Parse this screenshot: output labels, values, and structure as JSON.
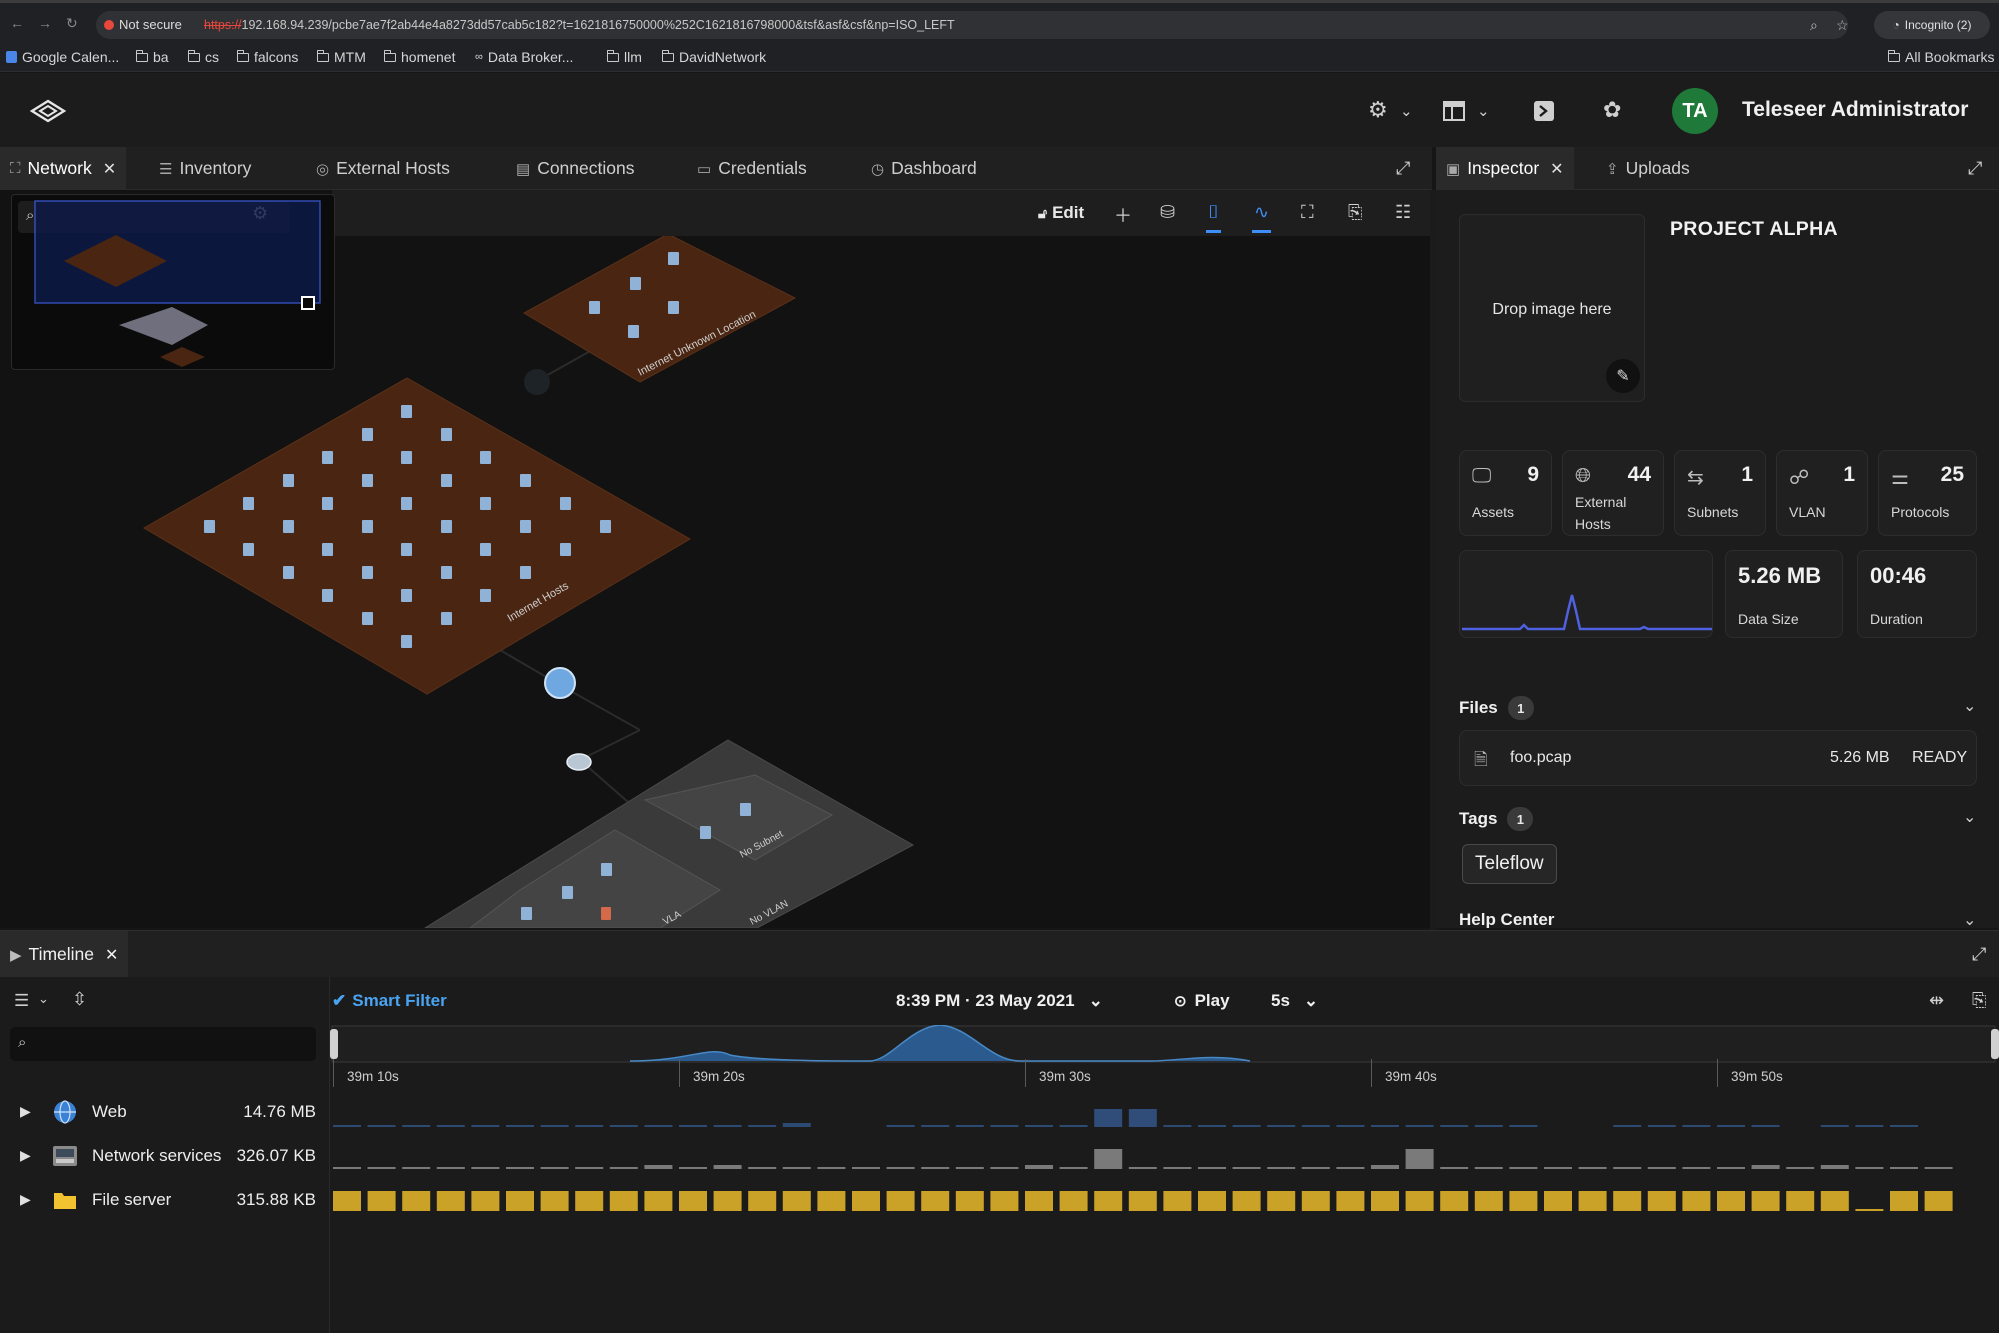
{
  "browser": {
    "not_secure": "Not secure",
    "url_scheme": "https://",
    "url_rest": "192.168.94.239/pcbe7ae7f2ab44e4a8273dd57cab5c182?t=1621816750000%252C1621816798000&tsf&asf&csf&np=ISO_LEFT",
    "incognito": "Incognito (2)",
    "bookmarks": [
      "Google Calen...",
      "ba",
      "cs",
      "falcons",
      "MTM",
      "homenet",
      "Data Broker...",
      "llm",
      "DavidNetwork"
    ],
    "all_bookmarks": "All Bookmarks"
  },
  "header": {
    "avatar_initials": "TA",
    "user_name": "Teleseer Administrator"
  },
  "tabs": [
    {
      "label": "Network",
      "icon": "network-icon"
    },
    {
      "label": "Inventory",
      "icon": "list-icon"
    },
    {
      "label": "External Hosts",
      "icon": "globe-icon"
    },
    {
      "label": "Connections",
      "icon": "connections-icon"
    },
    {
      "label": "Credentials",
      "icon": "credentials-icon"
    },
    {
      "label": "Dashboard",
      "icon": "dashboard-icon"
    }
  ],
  "right_tabs": [
    {
      "label": "Inspector",
      "icon": "inspector-icon"
    },
    {
      "label": "Uploads",
      "icon": "upload-icon"
    }
  ],
  "canvas": {
    "edit_label": "Edit",
    "zone_labels": [
      "Internet Unknown Location",
      "Internet Hosts",
      "No Subnet",
      "No VLAN",
      "VLA"
    ]
  },
  "inspector": {
    "drop_image": "Drop image here",
    "project_title": "PROJECT ALPHA",
    "stats": [
      {
        "value": "9",
        "label": "Assets",
        "icon": "monitor-icon"
      },
      {
        "value": "44",
        "label": "External Hosts",
        "icon": "globe-icon"
      },
      {
        "value": "1",
        "label": "Subnets",
        "icon": "arrows-icon"
      },
      {
        "value": "1",
        "label": "VLAN",
        "icon": "hierarchy-icon"
      },
      {
        "value": "25",
        "label": "Protocols",
        "icon": "protocols-icon"
      }
    ],
    "data_size": {
      "value": "5.26 MB",
      "label": "Data Size"
    },
    "duration": {
      "value": "00:46",
      "label": "Duration"
    },
    "files": {
      "title": "Files",
      "count": "1",
      "items": [
        {
          "name": "foo.pcap",
          "size": "5.26 MB",
          "status": "READY"
        }
      ]
    },
    "tags": {
      "title": "Tags",
      "count": "1",
      "items": [
        "Teleflow"
      ]
    },
    "help": {
      "title": "Help Center"
    }
  },
  "timeline": {
    "tab_label": "Timeline",
    "smart_filter": "Smart Filter",
    "datetime": "8:39 PM · 23 May 2021",
    "play": "Play",
    "speed": "5s",
    "ticks": [
      "39m 10s",
      "39m 20s",
      "39m 30s",
      "39m 40s",
      "39m 50s"
    ],
    "rows": [
      {
        "name": "Web",
        "size": "14.76 MB",
        "icon": "globe-icon",
        "color": "#2c4a72"
      },
      {
        "name": "Network services",
        "size": "326.07 KB",
        "icon": "server-icon",
        "color": "#7a7a7a"
      },
      {
        "name": "File server",
        "size": "315.88 KB",
        "icon": "folder-icon",
        "color": "#c9a227"
      }
    ]
  },
  "colors": {
    "accent": "#3e8ef7",
    "zone_orange": "#4a2512",
    "avatar": "#1f7a3a"
  }
}
